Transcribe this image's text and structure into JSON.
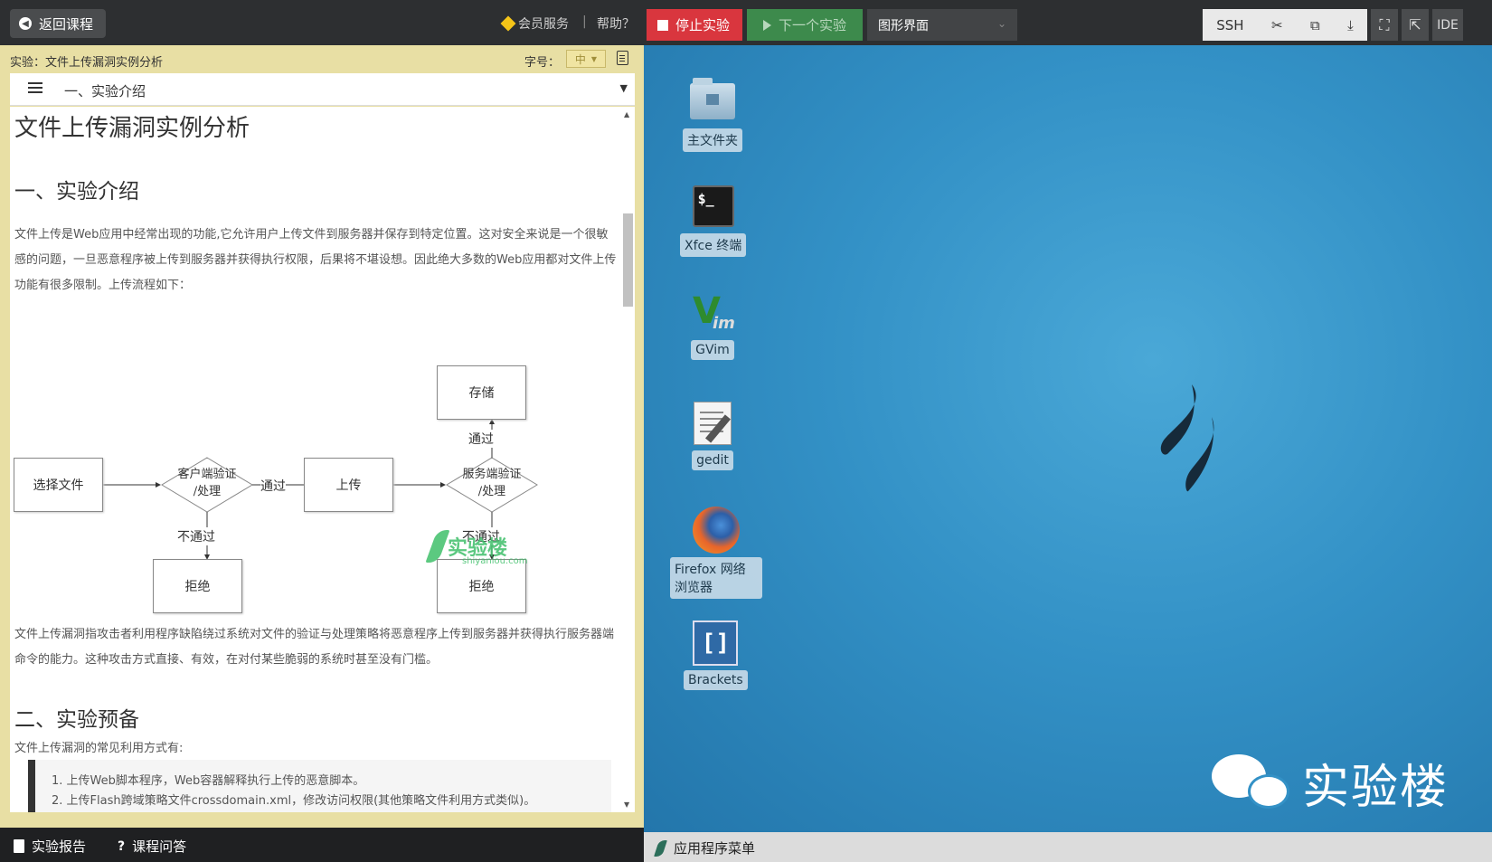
{
  "topbar": {
    "back_label": "返回课程",
    "vip_label": "会员服务",
    "separator": "|",
    "help_label": "帮助？",
    "stop_label": "停止实验",
    "next_label": "下一个实验",
    "mode_value": "图形界面",
    "tools": [
      "SSH",
      "✂",
      "⧉",
      "⤓"
    ],
    "ide_label": "IDE"
  },
  "lab": {
    "header": "实验：文件上传漏洞实例分析",
    "fontsize_label": "字号：",
    "fontsize_value": "中",
    "toc_current": "一、实验介绍"
  },
  "doc": {
    "title": "文件上传漏洞实例分析",
    "section1": "一、实验介绍",
    "para1": "文件上传是Web应用中经常出现的功能,它允许用户上传文件到服务器并保存到特定位置。这对安全来说是一个很敏感的问题，一旦恶意程序被上传到服务器并获得执行权限，后果将不堪设想。因此绝大多数的Web应用都对文件上传功能有很多限制。上传流程如下：",
    "flow": {
      "select": "选择文件",
      "client_a": "客户端验证",
      "client_b": "/处理",
      "pass1": "通过",
      "upload": "上传",
      "server_a": "服务端验证",
      "server_b": "/处理",
      "pass2": "通过",
      "store": "存储",
      "fail1": "不通过",
      "fail2": "不通过",
      "reject1": "拒绝",
      "reject2": "拒绝"
    },
    "watermark": "实验楼",
    "watermark_sub": "shiyanlou.com",
    "para2": "文件上传漏洞指攻击者利用程序缺陷绕过系统对文件的验证与处理策略将恶意程序上传到服务器并获得执行服务器端命令的能力。这种攻击方式直接、有效，在对付某些脆弱的系统时甚至没有门槛。",
    "section2": "二、实验预备",
    "para3": "文件上传漏洞的常见利用方式有:",
    "list1": "1. 上传Web脚本程序，Web容器解释执行上传的恶意脚本。",
    "list2": "2. 上传Flash跨域策略文件crossdomain.xml，修改访问权限(其他策略文件利用方式类似)。"
  },
  "bottombar": {
    "report_label": "实验报告",
    "qa_label": "课程问答"
  },
  "desktop": {
    "icons": [
      "主文件夹",
      "Xfce 终端",
      "GVim",
      "gedit",
      "Firefox 网络浏览器",
      "Brackets"
    ],
    "brand_text": "实验楼",
    "taskbar_menu": "应用程序菜单",
    "term_glyph": "$_"
  },
  "colors": {
    "stop": "#d9363e",
    "next": "#3d8a4c",
    "panel": "#e8dfa4",
    "desktop": "#3391c6"
  }
}
